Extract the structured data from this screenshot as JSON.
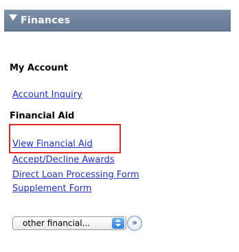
{
  "header": {
    "title": "Finances",
    "arrow_icon": "triangle-down-icon"
  },
  "sections": {
    "my_account": {
      "title": "My Account",
      "links": [
        "Account Inquiry"
      ]
    },
    "financial_aid": {
      "title": "Financial Aid",
      "links": [
        "View Financial Aid",
        "Accept/Decline Awards",
        "Direct Loan Processing Form",
        "Supplement Form"
      ]
    }
  },
  "dropdown": {
    "selected": "other financial...",
    "go_glyph": "»",
    "go_icon": "double-chevron-right-icon"
  },
  "colors": {
    "header_bg": "#6f829c",
    "link": "#1f31c7",
    "highlight": "#e0281e"
  }
}
